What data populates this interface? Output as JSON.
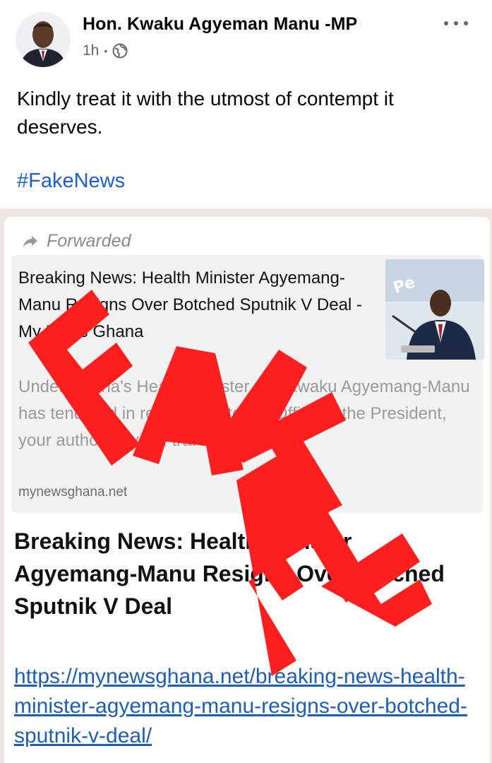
{
  "post": {
    "author": "Hon. Kwaku Agyeman Manu -MP",
    "time": "1h",
    "separator": "•",
    "privacy_icon": "globe-icon",
    "more_icon": "more-options-icon",
    "text": "Kindly treat it with the utmost of contempt it deserves.",
    "hashtag": "#FakeNews"
  },
  "shared_image": {
    "forwarded_label": "Forwarded",
    "forwarded_icon": "forward-arrow-icon",
    "preview": {
      "title": "Breaking News: Health Minister Agyemang-Manu Resigns Over Botched Sputnik V Deal - My News Ghana",
      "description": "Under Ghana's Health Minister, Mr. Kwaku Agyemang-Manu has tendered in resignation to the Office of the President, your authoritative ... tra.Com ca...",
      "domain": "mynewsghana.net"
    },
    "message_title": "Breaking News: Health Minister Agyemang-Manu Resigns Over Botched Sputnik V Deal",
    "message_link": "https://mynewsghana.net/breaking-news-health-minister-agyemang-manu-resigns-over-botched-sputnik-v-deal/",
    "stamp_text": "FAKE",
    "stamp_color": "#ff1f1f"
  },
  "colors": {
    "link_blue": "#1c5fb8",
    "hashtag_blue": "#1b5fd1",
    "meta_gray": "#65676b",
    "chat_background": "#efe7df"
  }
}
